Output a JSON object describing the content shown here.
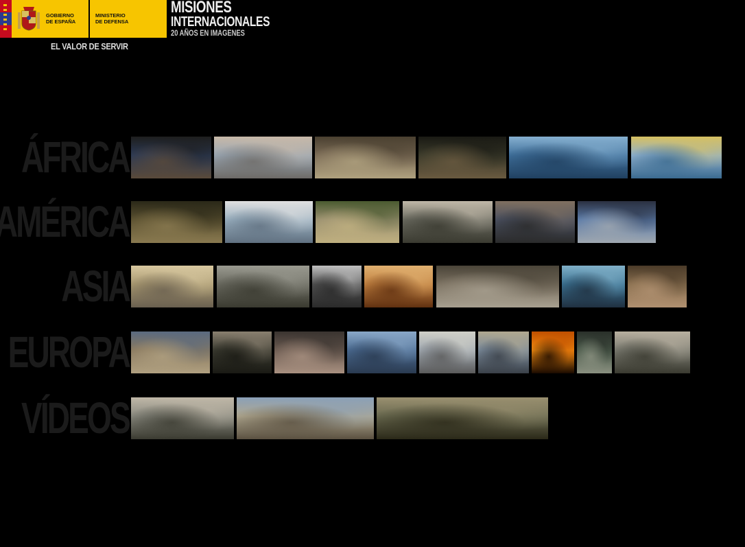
{
  "header": {
    "gobierno_line1": "GOBIERNO",
    "gobierno_line2": "DE ESPAÑA",
    "ministerio_line1": "MINISTERIO",
    "ministerio_line2": "DE DEFENSA",
    "slogan": "EL VALOR DE SERVIR",
    "title_line1": "MISIONES",
    "title_line2": "INTERNACIONALES",
    "title_line3": "20 AÑOS EN IMAGENES"
  },
  "regions": [
    {
      "label": "ÁFRICA",
      "thumbs": [
        {
          "scene": "troops-crowd-photo",
          "colors": [
            "#2c3a55",
            "#1e1e1e",
            "#5a4a3a"
          ]
        },
        {
          "scene": "aircraft-sky-photo",
          "colors": [
            "#9aa7b4",
            "#c8b9a8",
            "#6d6a66"
          ]
        },
        {
          "scene": "soldiers-local-photo",
          "colors": [
            "#7a6a55",
            "#4a4030",
            "#b0a27f"
          ]
        },
        {
          "scene": "soldier-closeup-photo",
          "colors": [
            "#3a3a2a",
            "#1a1a14",
            "#6a5a40"
          ]
        },
        {
          "scene": "ship-sea-photo",
          "colors": [
            "#3f6f9a",
            "#86b0d0",
            "#204060"
          ]
        },
        {
          "scene": "boat-harbor-photo",
          "colors": [
            "#8fb0cc",
            "#d7c060",
            "#3a6a90"
          ]
        }
      ]
    },
    {
      "label": "AMÉRICA",
      "thumbs": [
        {
          "scene": "soldier-field-photo",
          "colors": [
            "#5a5030",
            "#2a2818",
            "#8a7a50"
          ]
        },
        {
          "scene": "naval-vessel-photo",
          "colors": [
            "#9ab0c0",
            "#e0e0e0",
            "#607080"
          ]
        },
        {
          "scene": "soldiers-desert-photo",
          "colors": [
            "#9a9070",
            "#4a5a30",
            "#c0b080"
          ]
        },
        {
          "scene": "crowd-street-photo",
          "colors": [
            "#6a6a60",
            "#c0b8a8",
            "#3a3a30"
          ]
        },
        {
          "scene": "soldiers-patrol-photo",
          "colors": [
            "#4a5060",
            "#807060",
            "#2a2a2a"
          ]
        },
        {
          "scene": "bluehelmets-photo",
          "colors": [
            "#5a7aa8",
            "#2a3040",
            "#a0a8b0"
          ]
        }
      ]
    },
    {
      "label": "ASIA",
      "thumbs": [
        {
          "scene": "desert-landscape-photo",
          "colors": [
            "#a89870",
            "#d8c8a0",
            "#6a6050"
          ]
        },
        {
          "scene": "troops-formation-photo",
          "colors": [
            "#6a6a60",
            "#9a9a90",
            "#3a3a30"
          ]
        },
        {
          "scene": "soldiers-map-photo",
          "colors": [
            "#505050",
            "#c0c0c0",
            "#2a2a2a"
          ]
        },
        {
          "scene": "child-food-photo",
          "colors": [
            "#c08040",
            "#e0b070",
            "#603010"
          ]
        },
        {
          "scene": "convoy-photo",
          "colors": [
            "#7a7060",
            "#4a4438",
            "#a8a090"
          ]
        },
        {
          "scene": "coast-boats-photo",
          "colors": [
            "#3a7090",
            "#80b0c8",
            "#203040"
          ]
        },
        {
          "scene": "soldier-kneel-photo",
          "colors": [
            "#8a7050",
            "#4a3a28",
            "#b09070"
          ]
        }
      ]
    },
    {
      "label": "EUROPA",
      "thumbs": [
        {
          "scene": "soldier-child-photo",
          "colors": [
            "#8a7a60",
            "#5a6a80",
            "#b0a080"
          ]
        },
        {
          "scene": "helmet-soldier-photo",
          "colors": [
            "#3a3a30",
            "#8a8070",
            "#1a1a14"
          ]
        },
        {
          "scene": "ruins-soldier-photo",
          "colors": [
            "#6a5a50",
            "#3a3430",
            "#a89080"
          ]
        },
        {
          "scene": "armored-vehicle-photo",
          "colors": [
            "#4a6a90",
            "#8aa8c8",
            "#2a3a50"
          ]
        },
        {
          "scene": "tower-ruins-photo",
          "colors": [
            "#a0a8b0",
            "#d0d0c8",
            "#5a5a5a"
          ]
        },
        {
          "scene": "bridge-soldier-photo",
          "colors": [
            "#7a8a9a",
            "#b0a890",
            "#3a4048"
          ]
        },
        {
          "scene": "sunset-silhouette-photo",
          "colors": [
            "#f08a10",
            "#c05000",
            "#1a0a00"
          ]
        },
        {
          "scene": "officer-portrait-photo",
          "colors": [
            "#4a5a4a",
            "#2a302a",
            "#8a9080"
          ]
        },
        {
          "scene": "jeeps-photo",
          "colors": [
            "#7a7a70",
            "#b8b0a0",
            "#3a3a30"
          ]
        }
      ]
    },
    {
      "label": "VÍDEOS",
      "thumbs": [
        {
          "scene": "aircraft-troops-photo",
          "colors": [
            "#8a8a80",
            "#c0b8a8",
            "#3a3a30"
          ]
        },
        {
          "scene": "mostar-bridge-photo",
          "colors": [
            "#b0a890",
            "#8aa0b8",
            "#5a5040"
          ]
        },
        {
          "scene": "soldiers-group-photo",
          "colors": [
            "#6a6a50",
            "#9a9070",
            "#2a2818"
          ]
        }
      ]
    }
  ]
}
